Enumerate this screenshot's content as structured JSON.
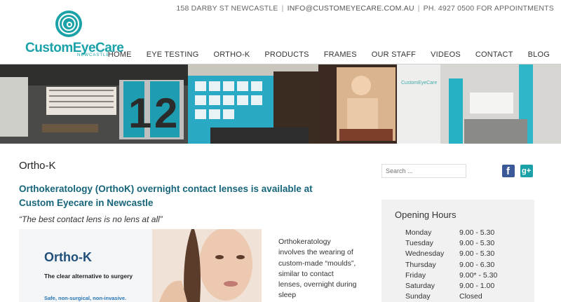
{
  "topbar": {
    "address": "158 DARBY ST NEWCASTLE",
    "email": "INFO@CUSTOMEYECARE.COM.AU",
    "phone": "PH. 4927 0500",
    "phone_suffix": "FOR APPOINTMENTS"
  },
  "logo": {
    "name": "CustomEyeCare",
    "sub": "NEWCASTLE",
    "icon": "eye-swirl-icon",
    "color": "#1aa2a8"
  },
  "nav": [
    "HOME",
    "EYE TESTING",
    "ORTHO-K",
    "PRODUCTS",
    "FRAMES",
    "OUR STAFF",
    "VIDEOS",
    "CONTACT",
    "BLOG"
  ],
  "page": {
    "title": "Ortho-K",
    "headline": "Orthokeratology (OrthoK) overnight contact lenses is available at Custom Eyecare in Newcastle",
    "quote": "“The best contact lens is no lens at all”",
    "body": "Orthokeratology  involves the wearing of custom-made “moulds”, similar to contact lenses, overnight during sleep"
  },
  "promo": {
    "title": "Ortho-K",
    "subtitle": "The clear alternative to surgery",
    "footer": "Safe, non-surgical, non-invasive."
  },
  "sidebar": {
    "search_placeholder": "Search ...",
    "social": [
      "facebook-icon",
      "google-plus-icon"
    ],
    "hours_title": "Opening Hours",
    "hours": [
      {
        "day": "Monday",
        "time": "9.00 - 5.30"
      },
      {
        "day": "Tuesday",
        "time": "9.00 - 5.30"
      },
      {
        "day": "Wednesday",
        "time": "9.00 - 5.30"
      },
      {
        "day": "Thursday",
        "time": "9.00 - 6.30"
      },
      {
        "day": "Friday",
        "time": "9.00* - 5.30"
      },
      {
        "day": "Saturday",
        "time": "9.00 - 1.00"
      },
      {
        "day": "Sunday",
        "time": "Closed"
      }
    ]
  },
  "colors": {
    "accent": "#1aa2a8",
    "headline": "#17657a",
    "promo_title": "#1f4f7a"
  }
}
